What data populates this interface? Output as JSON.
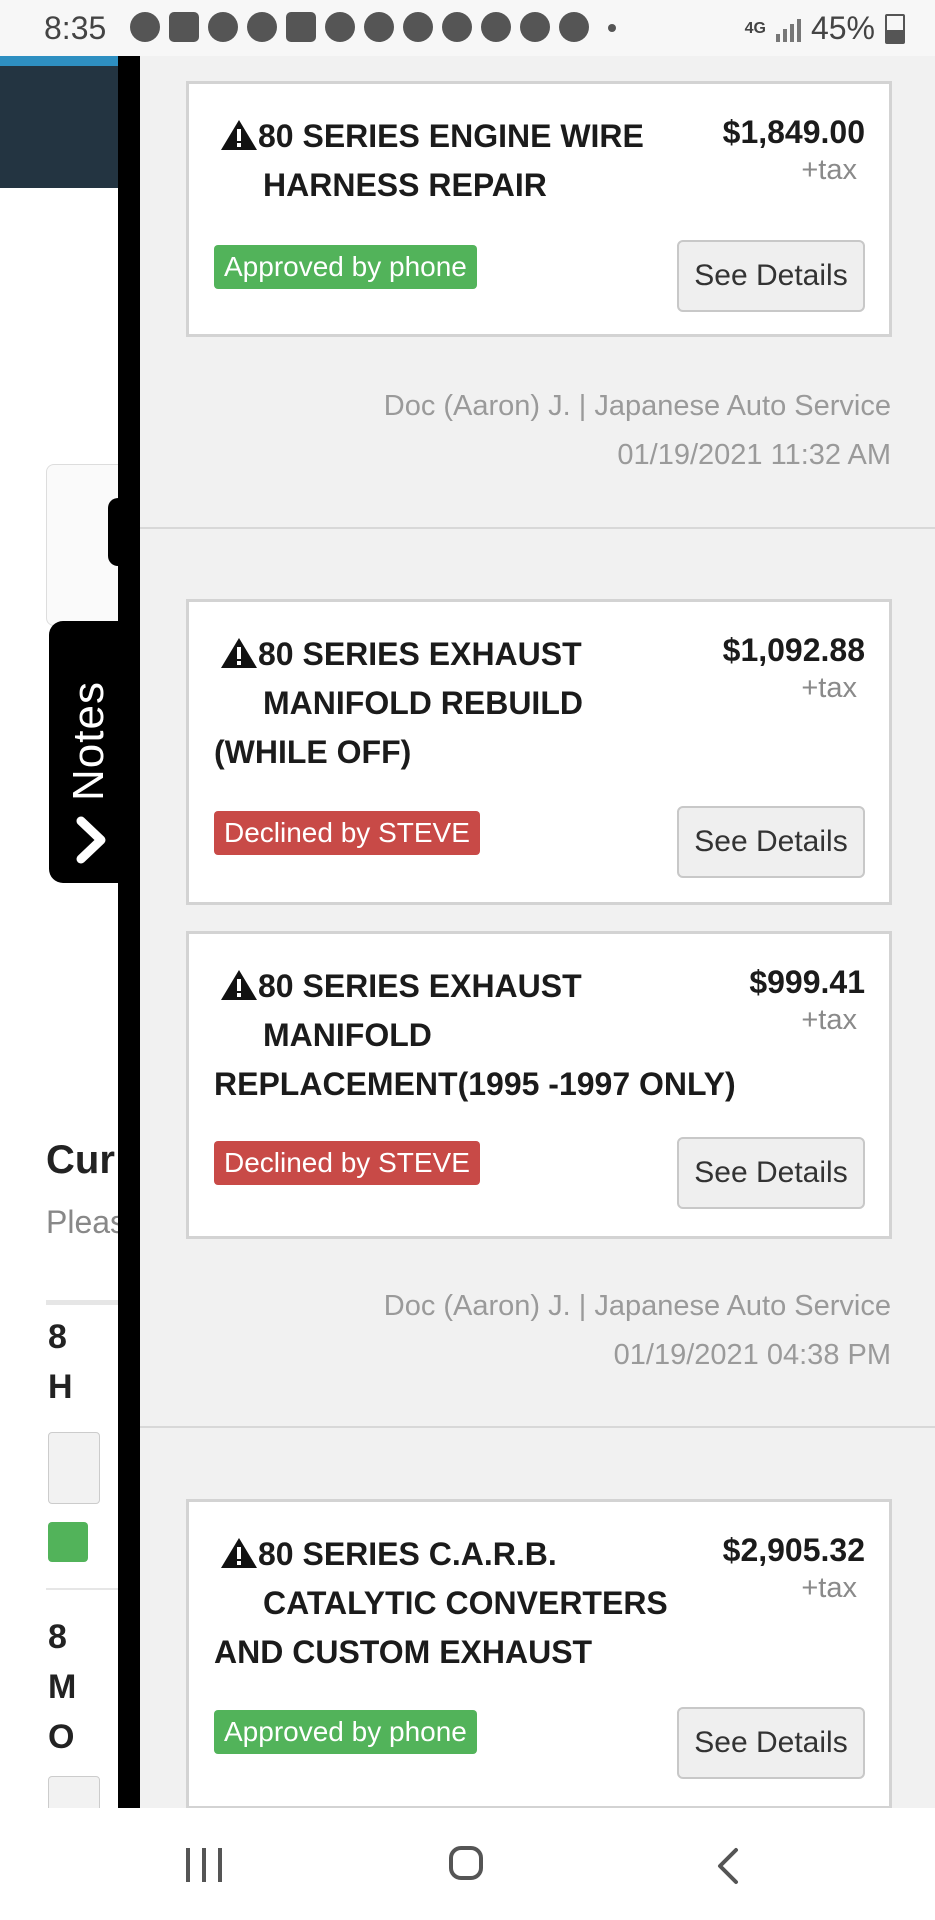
{
  "status_bar": {
    "time": "8:35",
    "network": "4G",
    "battery": "45%"
  },
  "notes_tab": {
    "label": "Notes"
  },
  "background_page": {
    "current_heading_partial": "Cur",
    "please_partial": "Pleas",
    "items": [
      {
        "line1": "8",
        "line2": "H"
      },
      {
        "line1": "8",
        "line2": "M",
        "line3": "O"
      }
    ]
  },
  "drawer": {
    "sections": [
      {
        "cards": [
          {
            "title_line1": "80 SERIES ENGINE WIRE",
            "title_rest": "HARNESS REPAIR",
            "price": "$1,849.00",
            "tax": "+tax",
            "status": "Approved by phone",
            "status_color": "#52b35a",
            "button": "See Details"
          }
        ],
        "author": "Doc (Aaron) J. | Japanese Auto Service",
        "timestamp": "01/19/2021 11:32 AM"
      },
      {
        "cards": [
          {
            "title_line1": "80 SERIES EXHAUST",
            "title_rest": "MANIFOLD REBUILD",
            "title_rest2": "(WHILE OFF)",
            "price": "$1,092.88",
            "tax": "+tax",
            "status": "Declined by STEVE",
            "status_color": "#c84a47",
            "button": "See Details"
          },
          {
            "title_line1": "80 SERIES EXHAUST",
            "title_rest": "MANIFOLD",
            "title_rest2": "REPLACEMENT(1995 -1997 ONLY)",
            "price": "$999.41",
            "tax": "+tax",
            "status": "Declined by STEVE",
            "status_color": "#c84a47",
            "button": "See Details"
          }
        ],
        "author": "Doc (Aaron) J. | Japanese Auto Service",
        "timestamp": "01/19/2021 04:38 PM"
      },
      {
        "cards": [
          {
            "title_line1": "80 SERIES C.A.R.B.",
            "title_rest": "CATALYTIC CONVERTERS",
            "title_rest2": "AND CUSTOM EXHAUST",
            "price": "$2,905.32",
            "tax": "+tax",
            "status": "Approved by phone",
            "status_color": "#52b35a",
            "button": "See Details"
          }
        ]
      }
    ]
  }
}
